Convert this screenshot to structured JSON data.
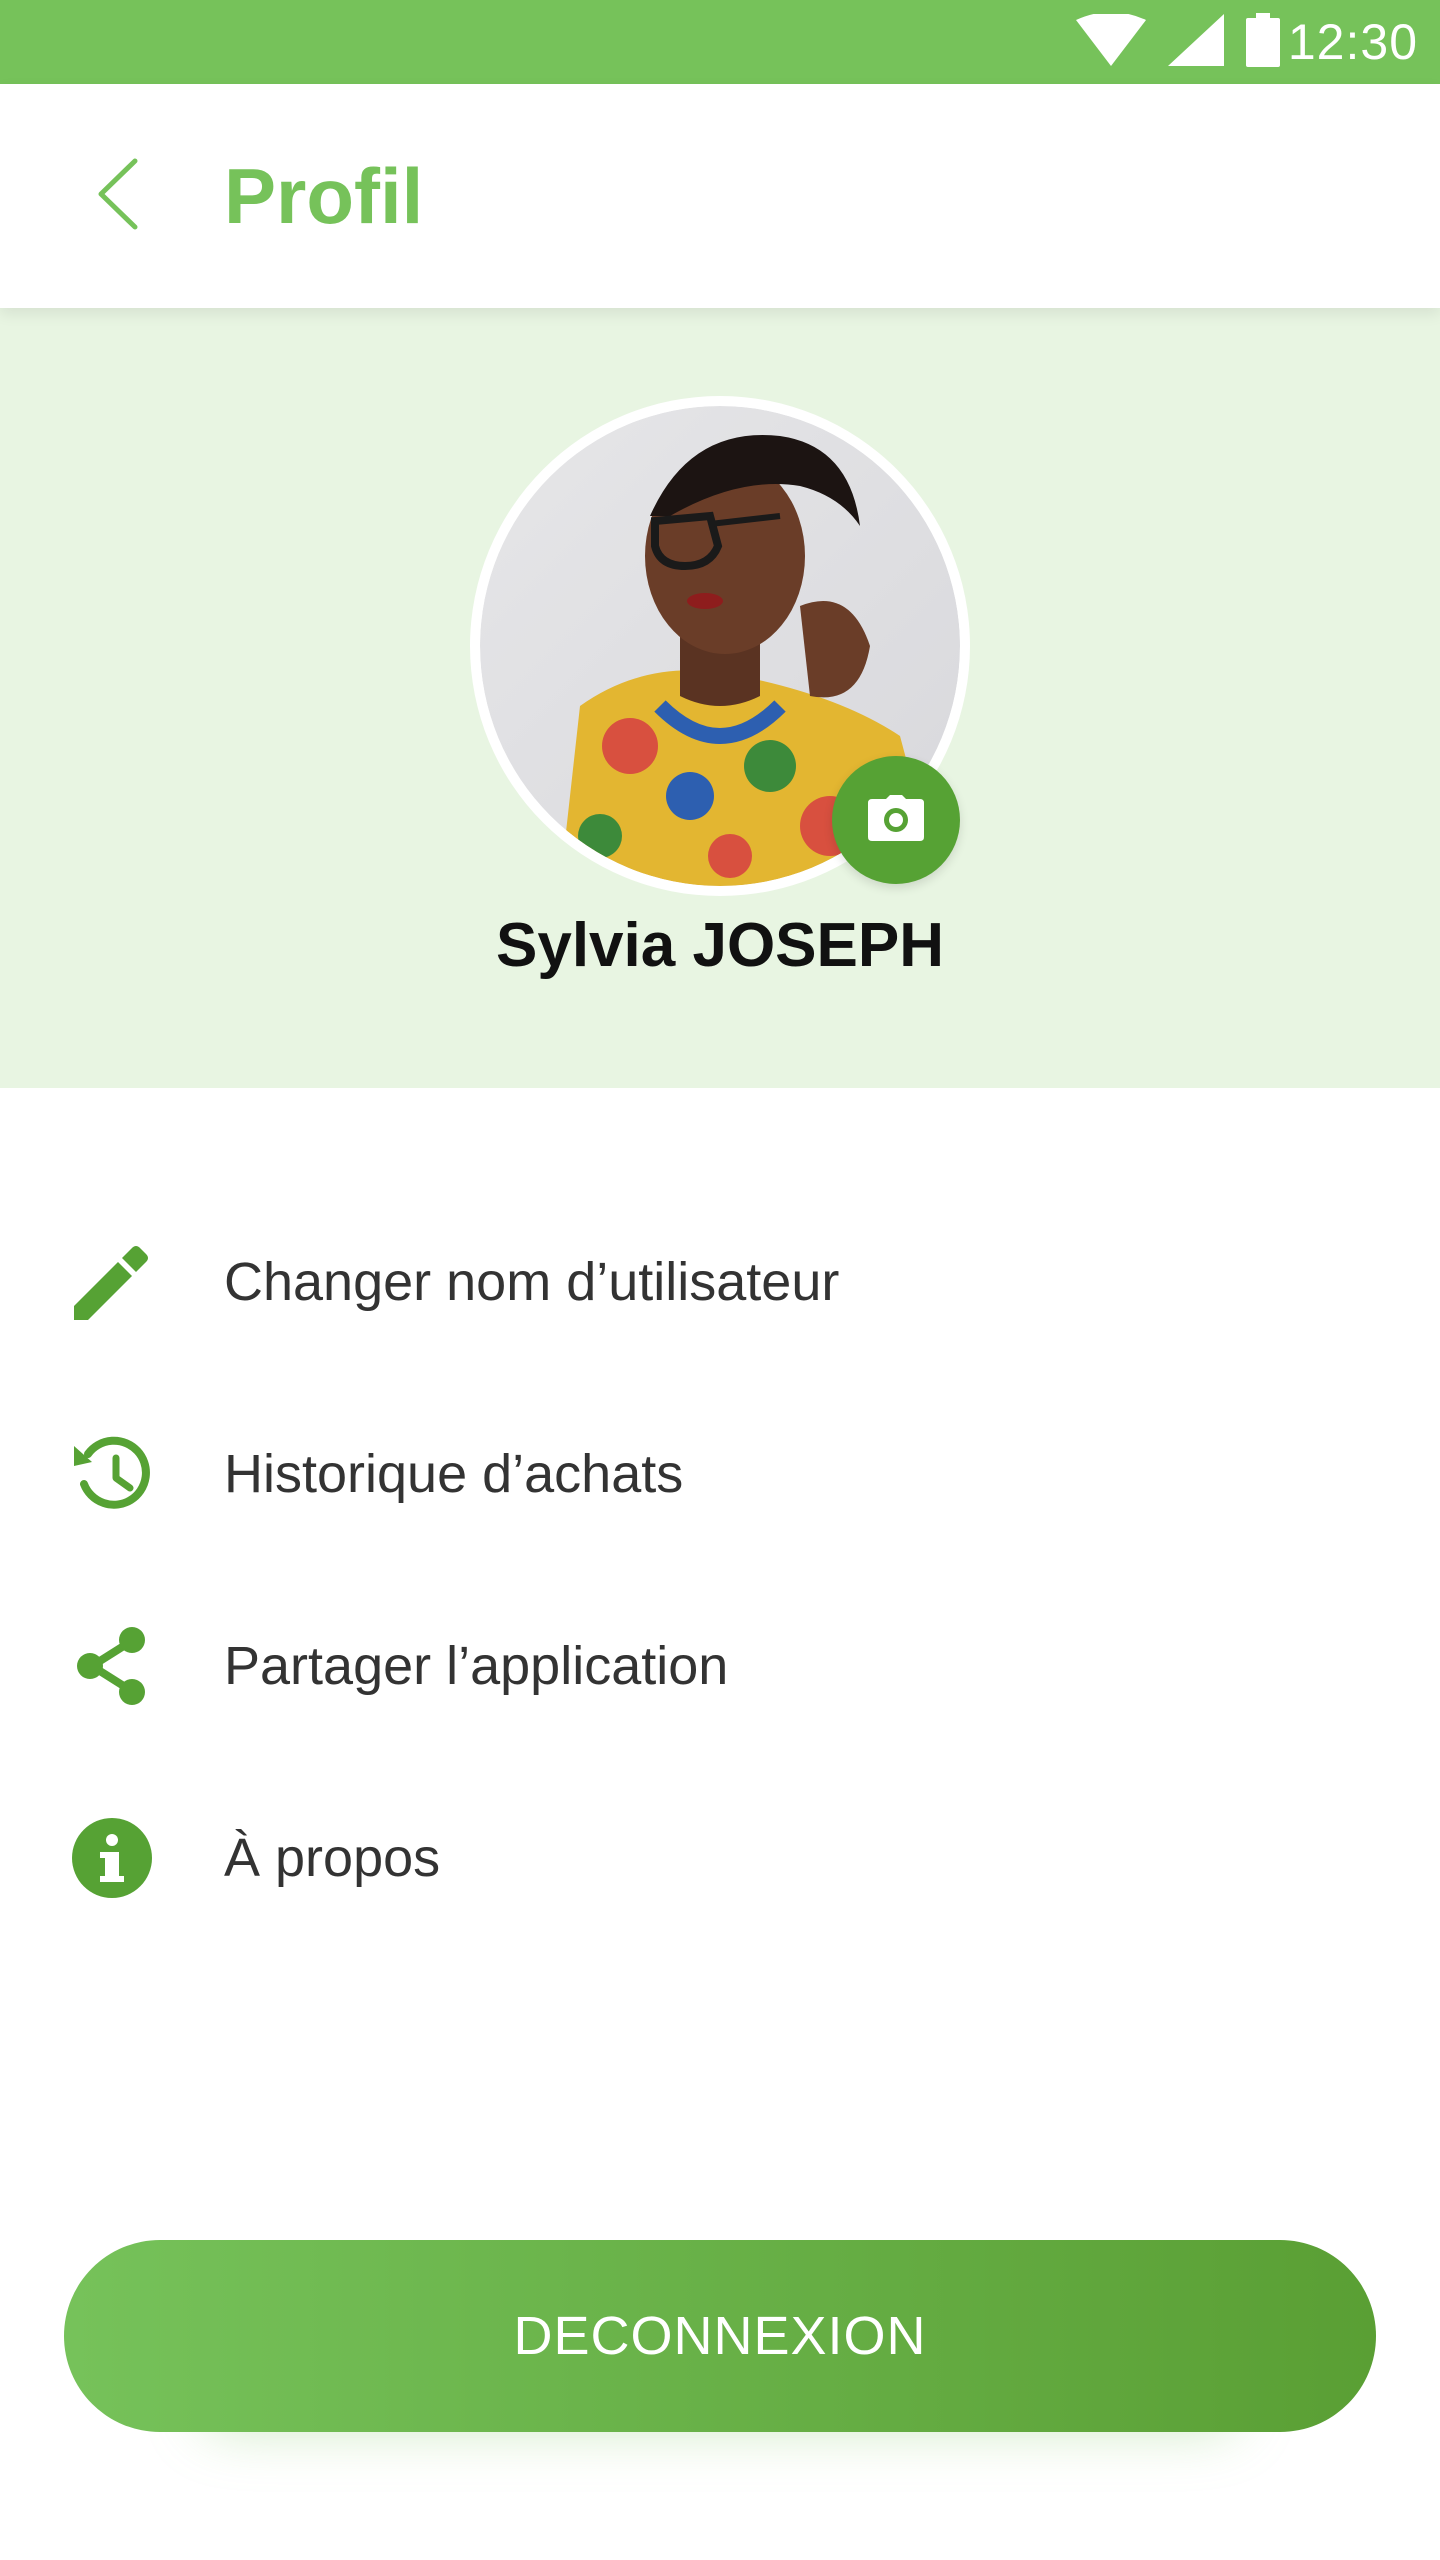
{
  "status_bar": {
    "time": "12:30",
    "icons": [
      "wifi-icon",
      "cell-signal-icon",
      "battery-icon"
    ],
    "background": "#76c25a"
  },
  "app_bar": {
    "back_icon": "chevron-left-icon",
    "title": "Profil"
  },
  "profile": {
    "avatar": "profile-photo",
    "camera_icon": "camera-icon",
    "name": "Sylvia JOSEPH",
    "header_background": "#e8f5e2"
  },
  "menu": {
    "items": [
      {
        "icon": "pencil-icon",
        "label": "Changer nom d’utilisateur"
      },
      {
        "icon": "history-icon",
        "label": "Historique d’achats"
      },
      {
        "icon": "share-icon",
        "label": "Partager l’application"
      },
      {
        "icon": "info-icon",
        "label": "À propos"
      }
    ]
  },
  "logout": {
    "label": "DECONNEXION"
  },
  "colors": {
    "accent": "#76c25a",
    "accent_dark": "#56a234",
    "text": "#333333"
  }
}
